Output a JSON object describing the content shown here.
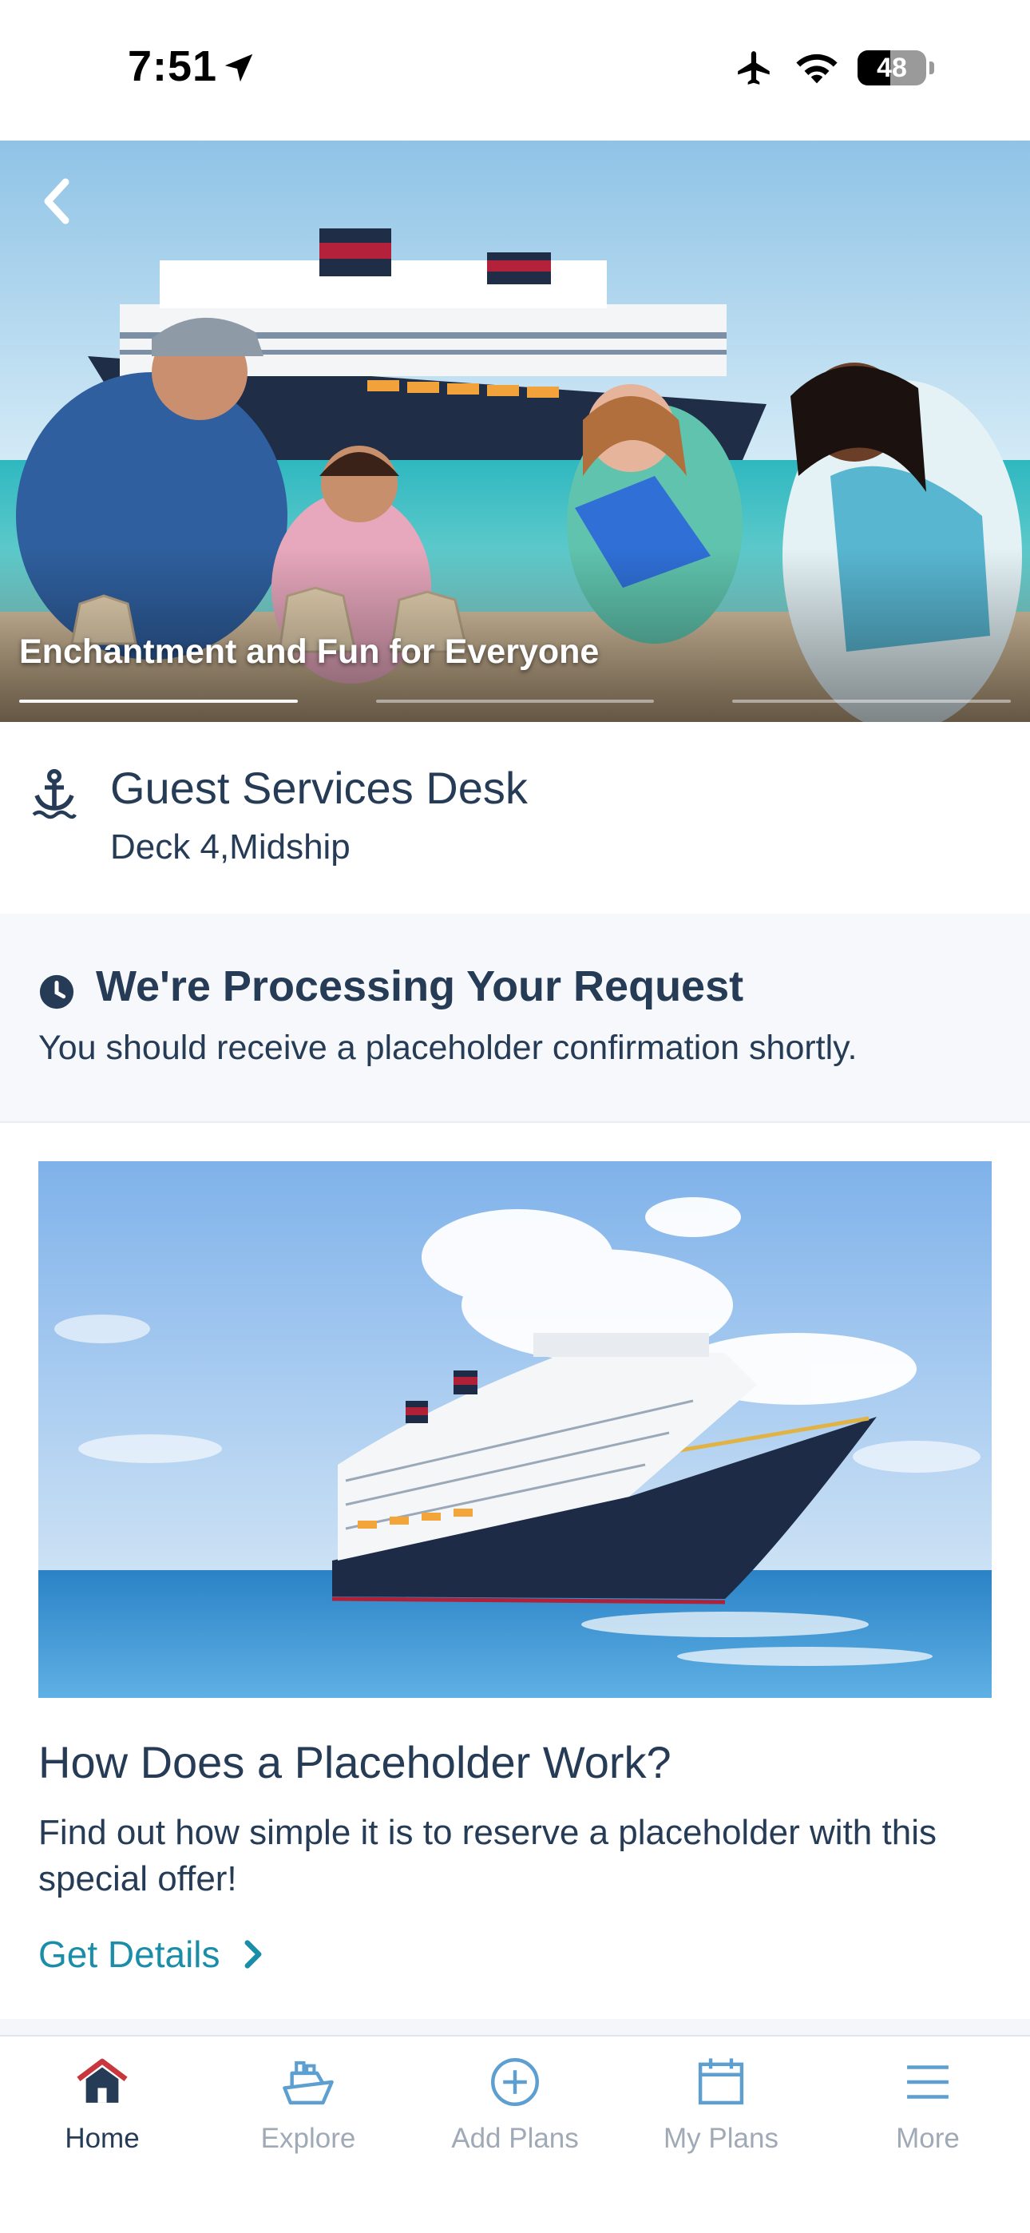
{
  "status_bar": {
    "time": "7:51",
    "battery": "48"
  },
  "hero": {
    "caption": "Enchantment and Fun for Everyone",
    "slide_count": 3,
    "active_slide": 1
  },
  "location": {
    "title": "Guest Services Desk",
    "subtitle": "Deck 4,Midship"
  },
  "processing": {
    "title": "We're Processing Your Request",
    "message": "You should receive a placeholder confirmation shortly."
  },
  "card": {
    "title": "How Does a Placeholder Work?",
    "description": "Find out how simple it is to reserve a placeholder with this special offer!",
    "link_label": "Get Details"
  },
  "tabs": [
    {
      "label": "Home",
      "icon": "home-icon",
      "active": true
    },
    {
      "label": "Explore",
      "icon": "ship-icon",
      "active": false
    },
    {
      "label": "Add Plans",
      "icon": "add-circle-icon",
      "active": false
    },
    {
      "label": "My Plans",
      "icon": "calendar-icon",
      "active": false
    },
    {
      "label": "More",
      "icon": "menu-icon",
      "active": false
    }
  ],
  "colors": {
    "text": "#253b56",
    "link": "#1a8ea9",
    "tab_inactive": "#a0aab6",
    "accent_red": "#c8373c"
  }
}
